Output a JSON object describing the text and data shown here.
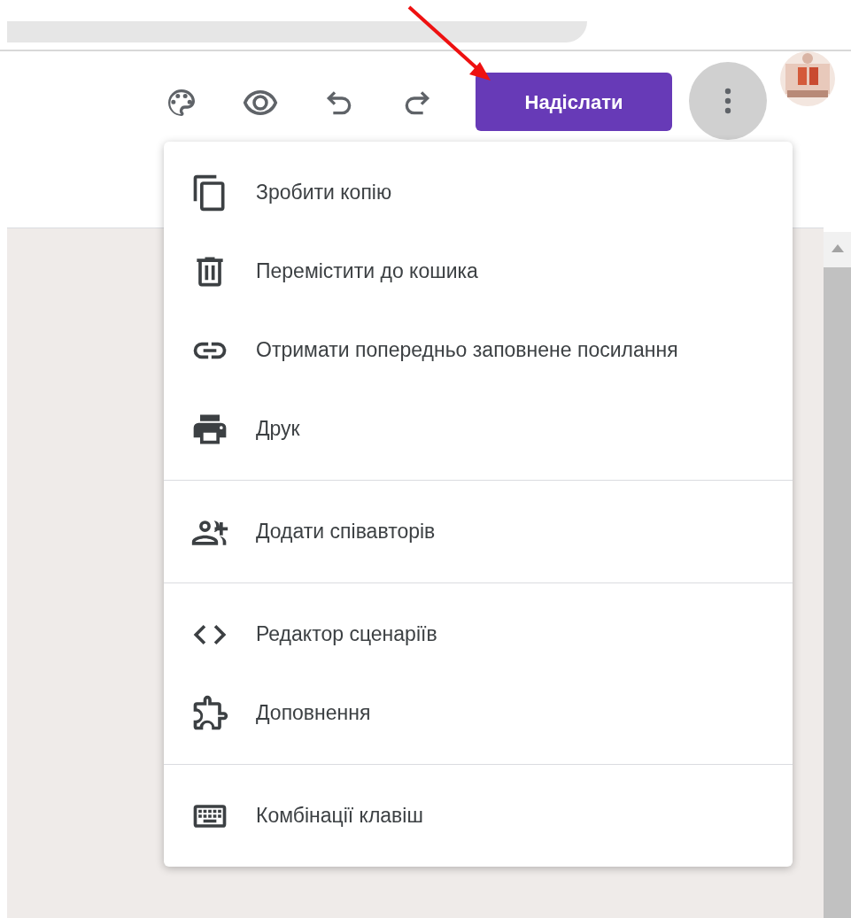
{
  "toolbar": {
    "send_button": "Надіслати",
    "more_button": {
      "selected": true
    }
  },
  "menu": {
    "groups": [
      [
        {
          "kind": "copy",
          "label": "Зробити копію"
        },
        {
          "kind": "trash",
          "label": "Перемістити до кошика"
        },
        {
          "kind": "link",
          "label": "Отримати попередньо заповнене посилання"
        },
        {
          "kind": "print",
          "label": "Друк"
        }
      ],
      [
        {
          "kind": "people",
          "label": "Додати співавторів"
        }
      ],
      [
        {
          "kind": "code",
          "label": "Редактор сценаріїв"
        },
        {
          "kind": "puzzle",
          "label": "Доповнення"
        }
      ],
      [
        {
          "kind": "keyboard",
          "label": "Комбінації клавіш"
        }
      ]
    ]
  }
}
